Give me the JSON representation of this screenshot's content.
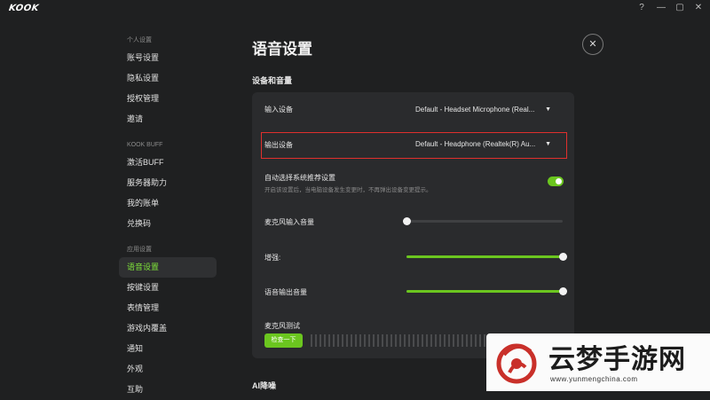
{
  "app": {
    "logo_text": "KOOK"
  },
  "window_controls": {
    "help": "?",
    "minimize": "—",
    "maximize": "▢",
    "close": "✕"
  },
  "sidebar": {
    "sections": [
      {
        "label": "个人设置",
        "items": [
          {
            "label": "账号设置"
          },
          {
            "label": "隐私设置"
          },
          {
            "label": "授权管理"
          },
          {
            "label": "邀请"
          }
        ]
      },
      {
        "label": "KOOK BUFF",
        "items": [
          {
            "label": "激活BUFF"
          },
          {
            "label": "服务器助力"
          },
          {
            "label": "我的账单"
          },
          {
            "label": "兑换码"
          }
        ]
      },
      {
        "label": "应用设置",
        "items": [
          {
            "label": "语音设置",
            "active": true
          },
          {
            "label": "按键设置"
          },
          {
            "label": "表情管理"
          },
          {
            "label": "游戏内覆盖"
          },
          {
            "label": "通知"
          },
          {
            "label": "外观"
          },
          {
            "label": "互助"
          }
        ]
      }
    ]
  },
  "main": {
    "title": "语音设置",
    "close_icon": "✕",
    "section_devices": "设备和音量",
    "input_device": {
      "label": "输入设备",
      "value": "Default - Headset Microphone (Real..."
    },
    "output_device": {
      "label": "输出设备",
      "value": "Default - Headphone (Realtek(R) Au..."
    },
    "auto_select": {
      "label": "自动选择系统推荐设置",
      "desc": "开启该设置后，当电脑设备发生变更时，不再弹出设备变更提示。",
      "enabled": true
    },
    "mic_volume": {
      "label": "麦克风输入音量",
      "value": 0
    },
    "gain": {
      "label": "增强:",
      "value": 100
    },
    "output_volume": {
      "label": "语音输出音量",
      "value": 100
    },
    "mic_test": {
      "label": "麦克风测试",
      "button": "检查一下"
    },
    "section_ai": "AI降噪"
  },
  "watermark": {
    "title": "云梦手游网",
    "url": "www.yunmengchina.com"
  },
  "colors": {
    "accent": "#6bc61f",
    "highlight_border": "#e0302d",
    "background": "#1f2021",
    "panel": "#2a2b2d"
  }
}
